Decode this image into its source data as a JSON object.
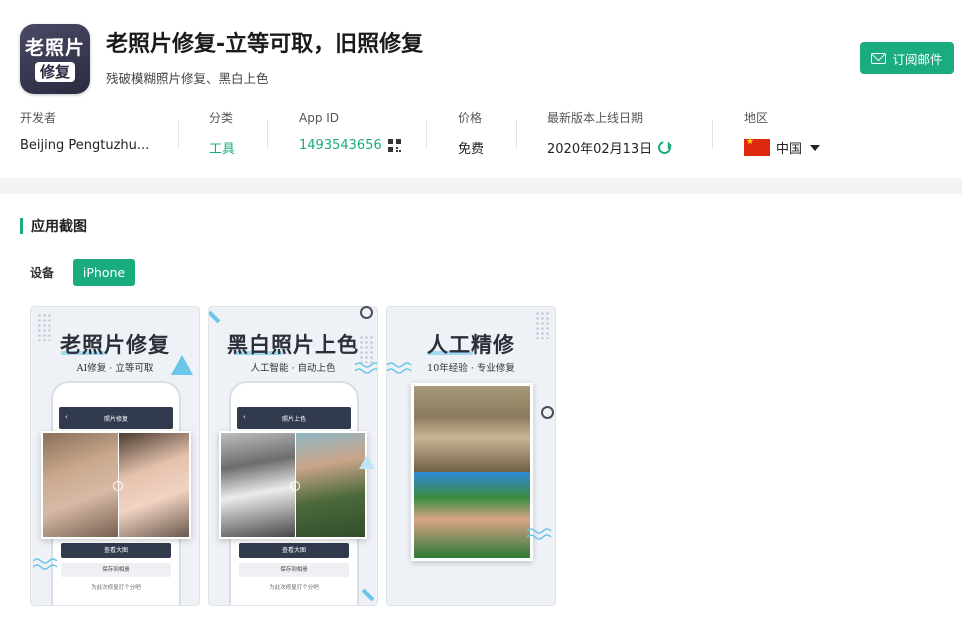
{
  "app": {
    "icon_line1": "老照片",
    "icon_line2": "修复",
    "title": "老照片修复-立等可取，旧照修复",
    "subtitle": "残破模糊照片修复、黑白上色"
  },
  "subscribe": {
    "label": "订阅邮件",
    "icon": "mail-icon"
  },
  "meta": {
    "developer": {
      "label": "开发者",
      "value": "Beijing Pengtuzhu..."
    },
    "category": {
      "label": "分类",
      "value": "工具"
    },
    "app_id": {
      "label": "App ID",
      "value": "1493543656",
      "icon": "qr-code-icon"
    },
    "price": {
      "label": "价格",
      "value": "免费"
    },
    "release": {
      "label": "最新版本上线日期",
      "value": "2020年02月13日",
      "icon": "refresh-icon"
    },
    "region": {
      "label": "地区",
      "value": "中国",
      "flag": "cn-flag-icon"
    }
  },
  "screenshots_section": {
    "title": "应用截图",
    "device_label": "设备",
    "device_tab": "iPhone",
    "items": [
      {
        "title": "老照片修复",
        "subtitle": "AI修复 · 立等可取",
        "screen_title": "照片修复",
        "save_btn": "查看大图",
        "sub_btn": "保存到相册",
        "footer": "为此次修复打个分吧"
      },
      {
        "title": "黑白照片上色",
        "subtitle": "人工智能 · 自动上色",
        "screen_title": "照片上色",
        "save_btn": "查看大图",
        "sub_btn": "保存到相册",
        "footer": "为此次修复打个分吧"
      },
      {
        "title": "人工精修",
        "subtitle": "10年经验 · 专业修复"
      }
    ]
  },
  "colors": {
    "accent": "#1aab7e",
    "icon_bg": "#34344e",
    "phone_bar": "#323a4e",
    "band": "#f2f3f5"
  }
}
